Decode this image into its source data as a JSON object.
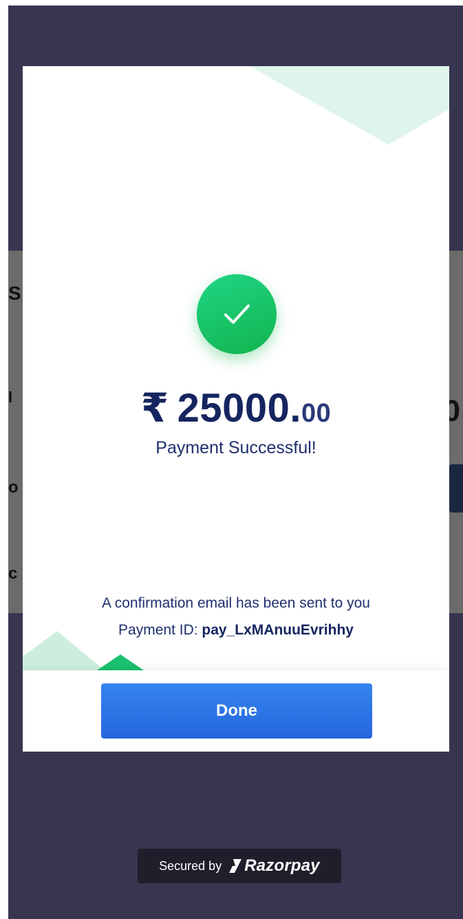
{
  "background_page": {
    "fragments": [
      "S",
      "l",
      "0",
      "o",
      "c"
    ]
  },
  "modal": {
    "amount": {
      "currency": "₹",
      "integer": "25000.",
      "decimals": "00"
    },
    "status_text": "Payment Successful!",
    "confirmation_text": "A confirmation email has been sent to you",
    "payment_id_label": "Payment ID:",
    "payment_id_value": "pay_LxMAnuuEvrihhy",
    "done_label": "Done"
  },
  "footer": {
    "secured_label": "Secured by",
    "brand_name": "Razorpay"
  },
  "colors": {
    "overlay": "#37354f",
    "success_green": "#12b44e",
    "accent_blue": "#2466dd",
    "text_navy": "#15255f",
    "deco_mint": "#dff4ea"
  },
  "icons": {
    "success": "check-icon",
    "brand": "razorpay-logo-icon"
  }
}
